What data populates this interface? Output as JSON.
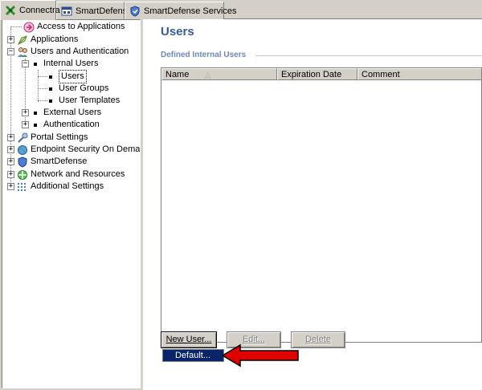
{
  "tabs": [
    {
      "label": "Connectra",
      "icon": "connectra-icon",
      "active": true
    },
    {
      "label": "SmartDefense",
      "icon": "smartdefense-icon",
      "active": false
    },
    {
      "label": "SmartDefense Services",
      "icon": "smartdefense-services-icon",
      "active": false
    }
  ],
  "tree": {
    "access": "Access to Applications",
    "applications": "Applications",
    "users_auth": "Users and Authentication",
    "internal_users": "Internal Users",
    "users": "Users",
    "user_groups": "User Groups",
    "user_templates": "User Templates",
    "external_users": "External Users",
    "authentication": "Authentication",
    "portal_settings": "Portal Settings",
    "endpoint": "Endpoint Security On Demand",
    "smartdefense": "SmartDefense",
    "network": "Network and Resources",
    "additional": "Additional Settings"
  },
  "main": {
    "title": "Users",
    "section": "Defined Internal Users",
    "columns": [
      "Name",
      "Expiration Date",
      "Comment"
    ],
    "sort_indicator": "△",
    "buttons": {
      "new_user": "New User...",
      "edit": "Edit...",
      "delete": "Delete"
    },
    "menu_item": "Default..."
  },
  "colors": {
    "title": "#385c99",
    "section": "#6d89bb",
    "selection": "#0a246a",
    "arrow": "#e00000"
  }
}
